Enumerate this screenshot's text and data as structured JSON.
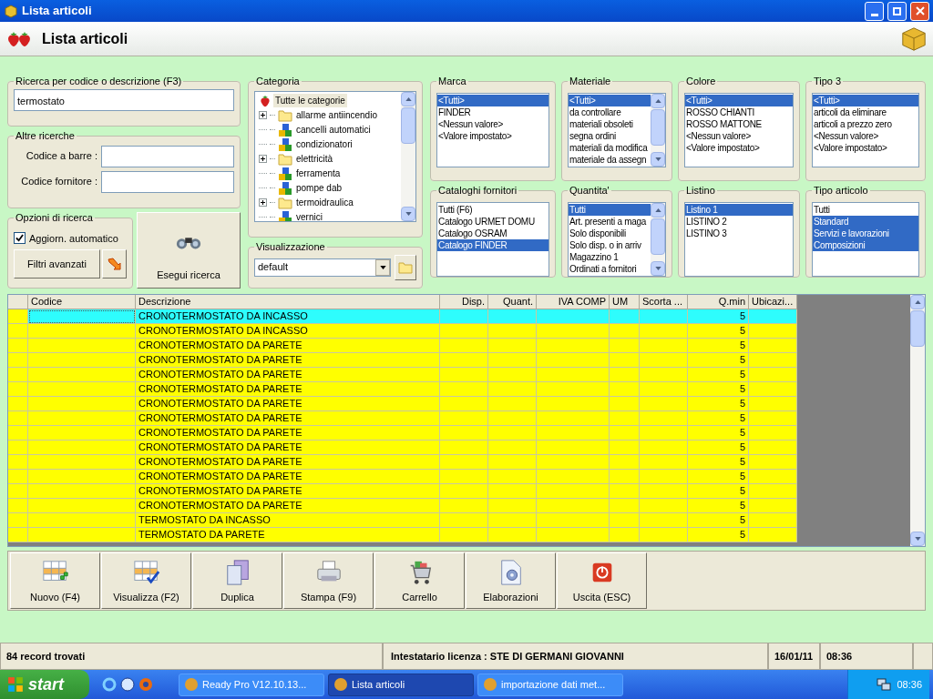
{
  "window": {
    "title": "Lista articoli"
  },
  "header": {
    "title": "Lista articoli"
  },
  "search": {
    "legend": "Ricerca per codice o descrizione (F3)",
    "value": "termostato"
  },
  "other_searches": {
    "legend": "Altre ricerche",
    "fields": [
      {
        "label": "Codice a barre :"
      },
      {
        "label": "Codice fornitore :"
      }
    ]
  },
  "options": {
    "legend": "Opzioni di ricerca",
    "auto_update": {
      "label": "Aggiorn. automatico",
      "checked": true
    },
    "advanced_button": "Filtri avanzati"
  },
  "run_button": "Esegui ricerca",
  "category": {
    "legend": "Categoria",
    "root": {
      "label": "Tutte le categorie",
      "selected": true,
      "children": [
        {
          "label": "allarme antiincendio",
          "expandable": true,
          "selected": false
        },
        {
          "label": "cancelli automatici",
          "expandable": false,
          "selected": false
        },
        {
          "label": "condizionatori",
          "expandable": false,
          "selected": false
        },
        {
          "label": "elettricità",
          "expandable": true,
          "selected": false
        },
        {
          "label": "ferramenta",
          "expandable": false,
          "selected": false
        },
        {
          "label": "pompe dab",
          "expandable": false,
          "selected": false
        },
        {
          "label": "termoidraulica",
          "expandable": true,
          "selected": false
        },
        {
          "label": "vernici",
          "expandable": false,
          "selected": false
        }
      ]
    }
  },
  "view": {
    "legend": "Visualizzazione",
    "value": "default"
  },
  "filters": [
    {
      "legend": "Marca",
      "scrollbar": false,
      "items": [
        {
          "label": "<Tutti>",
          "selected": true
        },
        {
          "label": "FINDER",
          "selected": false
        },
        {
          "label": "<Nessun valore>",
          "selected": false
        },
        {
          "label": "<Valore impostato>",
          "selected": false
        }
      ]
    },
    {
      "legend": "Materiale",
      "scrollbar": true,
      "items": [
        {
          "label": "<Tutti>",
          "selected": true
        },
        {
          "label": "da controllare",
          "selected": false
        },
        {
          "label": "materiali obsoleti",
          "selected": false
        },
        {
          "label": "segna ordini",
          "selected": false
        },
        {
          "label": "materiali da modifica",
          "selected": false
        },
        {
          "label": "materiale da assegn",
          "selected": false
        }
      ]
    },
    {
      "legend": "Colore",
      "scrollbar": false,
      "items": [
        {
          "label": "<Tutti>",
          "selected": true
        },
        {
          "label": "ROSSO CHIANTI",
          "selected": false
        },
        {
          "label": "ROSSO MATTONE",
          "selected": false
        },
        {
          "label": "<Nessun valore>",
          "selected": false
        },
        {
          "label": "<Valore impostato>",
          "selected": false
        }
      ]
    },
    {
      "legend": "Tipo 3",
      "scrollbar": false,
      "items": [
        {
          "label": "<Tutti>",
          "selected": true
        },
        {
          "label": "articoli da eliminare",
          "selected": false
        },
        {
          "label": "articoli a prezzo zero",
          "selected": false
        },
        {
          "label": "<Nessun valore>",
          "selected": false
        },
        {
          "label": "<Valore impostato>",
          "selected": false
        }
      ]
    },
    {
      "legend": "Cataloghi fornitori",
      "scrollbar": false,
      "items": [
        {
          "label": "Tutti (F6)",
          "selected": false
        },
        {
          "label": "Catalogo URMET DOMU",
          "selected": false
        },
        {
          "label": "Catalogo OSRAM",
          "selected": false
        },
        {
          "label": "Catalogo FINDER",
          "selected": true
        }
      ]
    },
    {
      "legend": "Quantita'",
      "scrollbar": true,
      "items": [
        {
          "label": "Tutti",
          "selected": true
        },
        {
          "label": "Art. presenti a maga",
          "selected": false
        },
        {
          "label": "Solo disponibili",
          "selected": false
        },
        {
          "label": "Solo disp. o in arriv",
          "selected": false
        },
        {
          "label": "Magazzino 1",
          "selected": false
        },
        {
          "label": "Ordinati a fornitori",
          "selected": false
        }
      ]
    },
    {
      "legend": "Listino",
      "scrollbar": false,
      "items": [
        {
          "label": "Listino 1",
          "selected": true
        },
        {
          "label": "LISTINO 2",
          "selected": false
        },
        {
          "label": "LISTINO 3",
          "selected": false
        }
      ]
    },
    {
      "legend": "Tipo articolo",
      "scrollbar": false,
      "items": [
        {
          "label": "Tutti",
          "selected": false
        },
        {
          "label": "Standard",
          "selected": true
        },
        {
          "label": "Servizi e lavorazioni",
          "selected": true
        },
        {
          "label": "Composizioni",
          "selected": true
        }
      ]
    }
  ],
  "table": {
    "columns": [
      "Codice",
      "Descrizione",
      "Disp.",
      "Quant.",
      "IVA COMP",
      "UM",
      "Scorta ...",
      "Q.min",
      "Ubicazi..."
    ],
    "rows": [
      {
        "descrizione": "CRONOTERMOSTATO DA INCASSO",
        "q_min": "5",
        "selected": true
      },
      {
        "descrizione": "CRONOTERMOSTATO DA INCASSO",
        "q_min": "5",
        "selected": false
      },
      {
        "descrizione": "CRONOTERMOSTATO DA PARETE",
        "q_min": "5",
        "selected": false
      },
      {
        "descrizione": "CRONOTERMOSTATO DA PARETE",
        "q_min": "5",
        "selected": false
      },
      {
        "descrizione": "CRONOTERMOSTATO DA PARETE",
        "q_min": "5",
        "selected": false
      },
      {
        "descrizione": "CRONOTERMOSTATO DA PARETE",
        "q_min": "5",
        "selected": false
      },
      {
        "descrizione": "CRONOTERMOSTATO DA PARETE",
        "q_min": "5",
        "selected": false
      },
      {
        "descrizione": "CRONOTERMOSTATO DA PARETE",
        "q_min": "5",
        "selected": false
      },
      {
        "descrizione": "CRONOTERMOSTATO DA PARETE",
        "q_min": "5",
        "selected": false
      },
      {
        "descrizione": "CRONOTERMOSTATO DA PARETE",
        "q_min": "5",
        "selected": false
      },
      {
        "descrizione": "CRONOTERMOSTATO DA PARETE",
        "q_min": "5",
        "selected": false
      },
      {
        "descrizione": "CRONOTERMOSTATO DA PARETE",
        "q_min": "5",
        "selected": false
      },
      {
        "descrizione": "CRONOTERMOSTATO DA PARETE",
        "q_min": "5",
        "selected": false
      },
      {
        "descrizione": "CRONOTERMOSTATO DA PARETE",
        "q_min": "5",
        "selected": false
      },
      {
        "descrizione": "TERMOSTATO DA INCASSO",
        "q_min": "5",
        "selected": false
      },
      {
        "descrizione": "TERMOSTATO DA PARETE",
        "q_min": "5",
        "selected": false
      }
    ]
  },
  "buttons": [
    "Nuovo (F4)",
    "Visualizza (F2)",
    "Duplica",
    "Stampa (F9)",
    "Carrello",
    "Elaborazioni",
    "Uscita (ESC)"
  ],
  "status_bar": {
    "count": "84 record trovati",
    "license": "Intestatario licenza : STE DI GERMANI GIOVANNI",
    "date": "16/01/11",
    "time": "08:36"
  },
  "taskbar": {
    "start": "start",
    "tasks": [
      {
        "label": "Ready Pro V12.10.13...",
        "selected": false
      },
      {
        "label": "Lista articoli",
        "selected": true
      },
      {
        "label": "importazione dati met...",
        "selected": false
      }
    ],
    "clock": "08:36"
  }
}
